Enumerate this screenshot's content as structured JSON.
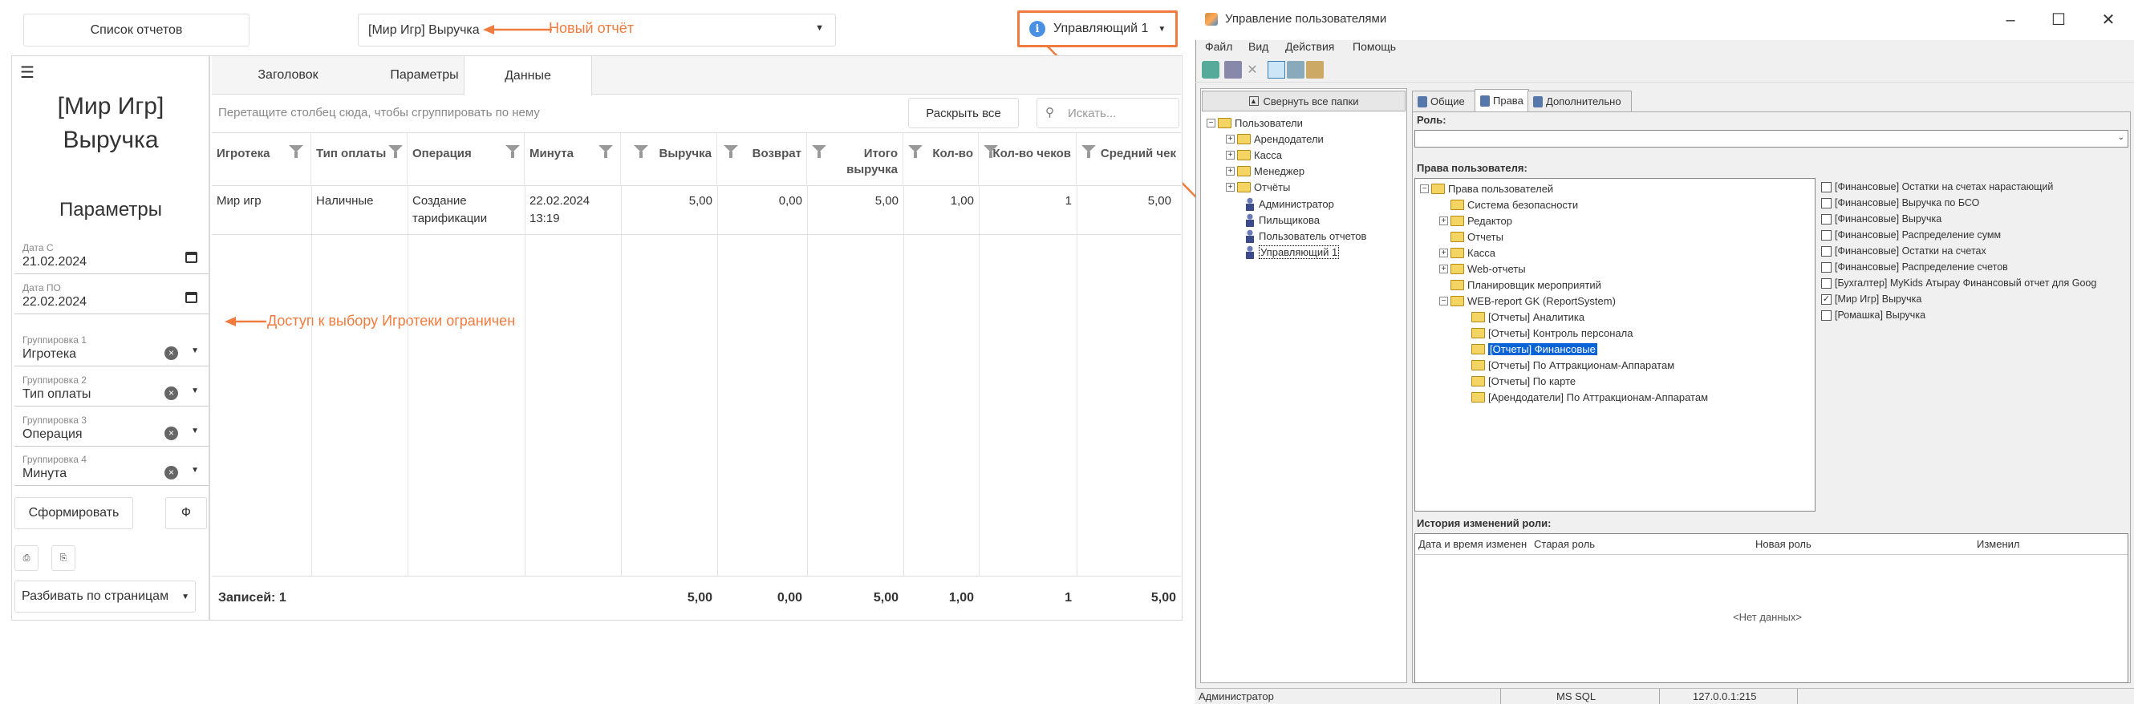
{
  "web": {
    "reports_list_btn": "Список отчетов",
    "report_select": "[Мир Игр] Выручка",
    "new_report_annotation": "Новый отчёт",
    "user_name": "Управляющий 1",
    "restriction_annotation": "Доступ к выбору Игротеки ограничен",
    "report_title_line1": "[Мир Игр]",
    "report_title_line2": "Выручка",
    "params_title": "Параметры",
    "fields": [
      {
        "label": "Дата С",
        "value": "21.02.2024",
        "kind": "date"
      },
      {
        "label": "Дата ПО",
        "value": "22.02.2024",
        "kind": "date"
      },
      {
        "label": "Группировка 1",
        "value": "Игротека",
        "kind": "select"
      },
      {
        "label": "Группировка 2",
        "value": "Тип оплаты",
        "kind": "select"
      },
      {
        "label": "Группировка 3",
        "value": "Операция",
        "kind": "select"
      },
      {
        "label": "Группировка 4",
        "value": "Минута",
        "kind": "select"
      }
    ],
    "generate_btn": "Сформировать",
    "f_btn": "Ф",
    "paging_select": "Разбивать по страницам",
    "tabs": [
      "Заголовок",
      "Параметры",
      "Данные"
    ],
    "active_tab": "Данные",
    "group_hint": "Перетащите столбец сюда, чтобы сгруппировать по нему",
    "expand_all_btn": "Раскрыть все",
    "search_placeholder": "Искать...",
    "columns": [
      "Игротека",
      "Тип оплаты",
      "Операция",
      "Минута",
      "Выручка",
      "Возврат",
      "Итого выручка",
      "Кол-во",
      "Кол-во чеков",
      "Средний чек"
    ],
    "rows": [
      [
        "Мир игр",
        "Наличные",
        "Создание тарификации",
        "22.02.2024 13:19",
        "5,00",
        "0,00",
        "5,00",
        "1,00",
        "1",
        "5,00"
      ]
    ],
    "footer_records": "Записей: 1",
    "footer_totals": [
      "5,00",
      "0,00",
      "5,00",
      "1,00",
      "1",
      "5,00"
    ]
  },
  "win": {
    "title": "Управление пользователями",
    "menu": [
      "Файл",
      "Вид",
      "Действия",
      "Помощь"
    ],
    "collapse_all": "Свернуть все папки",
    "tree": {
      "root": "Пользователи",
      "folders": [
        "Арендодатели",
        "Касса",
        "Менеджер",
        "Отчёты"
      ],
      "users": [
        "Администратор",
        "Пильщикова",
        "Пользователь отчетов",
        "Управляющий 1"
      ]
    },
    "tabs": [
      "Общие",
      "Права",
      "Дополнительно"
    ],
    "role_label": "Роль:",
    "rights_label": "Права пользователя:",
    "rights_tree": {
      "root": "Права пользователей",
      "items": [
        "Система безопасности",
        "Редактор",
        "Отчеты",
        "Касса",
        "Web-отчеты",
        "Планировщик мероприятий",
        "WEB-report GK (ReportSystem)"
      ],
      "sub": [
        "[Отчеты] Аналитика",
        "[Отчеты] Контроль персонала",
        "[Отчеты] Финансовые",
        "[Отчеты]  По Аттракционам-Аппаратам",
        "[Отчеты] По карте",
        "[Арендодатели] По Аттракционам-Аппаратам"
      ]
    },
    "rights_checks": [
      {
        "label": "[Финансовые] Остатки на счетах нарастающий",
        "checked": false
      },
      {
        "label": "[Финансовые] Выручка по БСО",
        "checked": false
      },
      {
        "label": "[Финансовые] Выручка",
        "checked": false
      },
      {
        "label": "[Финансовые] Распределение сумм",
        "checked": false
      },
      {
        "label": "[Финансовые] Остатки на счетах",
        "checked": false
      },
      {
        "label": "[Финансовые] Распределение счетов",
        "checked": false
      },
      {
        "label": "[Бухгалтер] MyKids Атырау Финансовый отчет для Goog",
        "checked": false
      },
      {
        "label": "[Мир Игр] Выручка",
        "checked": true
      },
      {
        "label": "[Ромашка] Выручка",
        "checked": false
      }
    ],
    "history_label": "История изменений роли:",
    "history_cols": [
      "Дата и время изменен",
      "Старая роль",
      "Новая роль",
      "Изменил"
    ],
    "no_data": "<Нет данных>",
    "status": [
      "Администратор",
      "MS SQL",
      "127.0.0.1:215"
    ]
  },
  "colors": {
    "accent": "#f07b3f",
    "selection": "#0a64d6"
  }
}
